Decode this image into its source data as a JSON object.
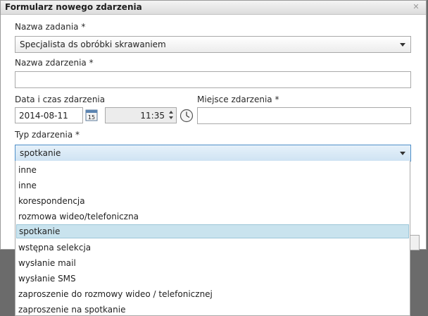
{
  "dialog": {
    "title": "Formularz nowego zdarzenia",
    "close_icon": "close-icon"
  },
  "form": {
    "task_name_label": "Nazwa zadania *",
    "task_name_value": "Specjalista ds obróbki skrawaniem",
    "event_name_label": "Nazwa zdarzenia *",
    "event_name_value": "",
    "datetime_label": "Data i czas zdarzenia",
    "date_value": "2014-08-11",
    "calendar_day": "15",
    "time_value": "11:35",
    "place_label": "Miejsce zdarzenia *",
    "place_value": "",
    "type_label": "Typ zdarzenia *",
    "type_value": "spotkanie"
  },
  "dropdown": {
    "selected": "spotkanie",
    "options": [
      "inne",
      "inne",
      "korespondencja",
      "rozmowa wideo/telefoniczna",
      "spotkanie",
      "wstępna selekcja",
      "wysłanie mail",
      "wysłanie SMS",
      "zaproszenie do rozmowy wideo / telefonicznej",
      "zaproszenie na spotkanie"
    ]
  },
  "colors": {
    "selected_option_bg": "#c9e3ee",
    "open_select_border": "#4f8fc8",
    "backdrop": "#6b6b6b"
  },
  "icons": [
    "close-icon",
    "calendar-icon",
    "clock-icon",
    "dropdown-arrow-icon",
    "spin-up-icon",
    "spin-down-icon"
  ]
}
